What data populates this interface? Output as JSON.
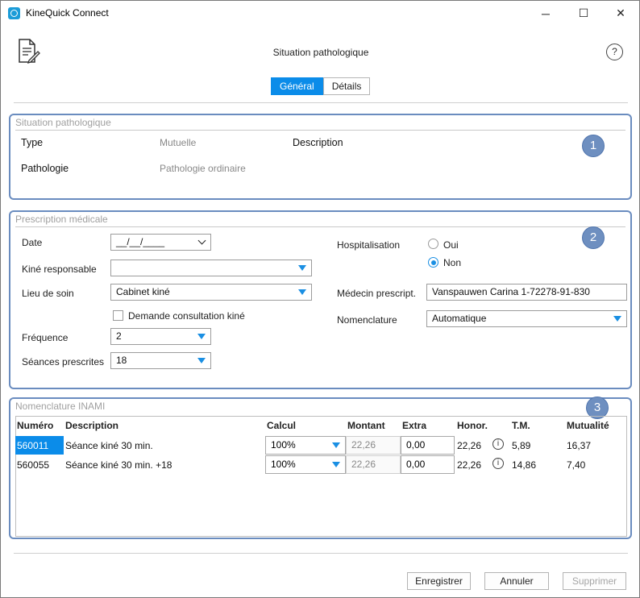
{
  "window": {
    "title": "KineQuick Connect",
    "minimize": "─",
    "maximize": "☐",
    "close": "✕"
  },
  "header": {
    "page_title": "Situation pathologique",
    "help": "?"
  },
  "tabs": [
    {
      "label": "Général",
      "active": true
    },
    {
      "label": "Détails",
      "active": false
    }
  ],
  "situation": {
    "legend": "Situation pathologique",
    "badge": "1",
    "type_label": "Type",
    "type_value": "Mutuelle",
    "description_label": "Description",
    "pathologie_label": "Pathologie",
    "pathologie_value": "Pathologie ordinaire"
  },
  "prescription": {
    "legend": "Prescription médicale",
    "badge": "2",
    "date_label": "Date",
    "date_value": "__/__/____",
    "kine_label": "Kiné responsable",
    "kine_value": "",
    "lieu_label": "Lieu de soin",
    "lieu_value": "Cabinet kiné",
    "consult_label": "Demande consultation kiné",
    "consult_checked": false,
    "frequence_label": "Fréquence",
    "frequence_value": "2",
    "seances_label": "Séances prescrites",
    "seances_value": "18",
    "hosp_label": "Hospitalisation",
    "hosp_oui": "Oui",
    "hosp_non": "Non",
    "hosp_selected": "Non",
    "medecin_label": "Médecin prescript.",
    "medecin_value": "Vanspauwen Carina  1-72278-91-830",
    "nomenclature_label": "Nomenclature",
    "nomenclature_value": "Automatique"
  },
  "inami": {
    "legend": "Nomenclature INAMI",
    "badge": "3",
    "columns": [
      "Numéro",
      "Description",
      "Calcul",
      "Montant",
      "Extra",
      "Honor.",
      "T.M.",
      "Mutualité"
    ],
    "rows": [
      {
        "numero": "560011",
        "description": "Séance kiné 30 min.",
        "calcul": "100%",
        "montant": "22,26",
        "extra": "0,00",
        "honor": "22,26",
        "tm": "5,89",
        "mutualite": "16,37",
        "selected": true
      },
      {
        "numero": "560055",
        "description": "Séance kiné 30 min. +18",
        "calcul": "100%",
        "montant": "22,26",
        "extra": "0,00",
        "honor": "22,26",
        "tm": "14,86",
        "mutualite": "7,40",
        "selected": false
      }
    ],
    "info_glyph": "i"
  },
  "footer": {
    "save": "Enregistrer",
    "cancel": "Annuler",
    "delete": "Supprimer"
  },
  "colors": {
    "accent": "#0b8ce9",
    "group_border": "#6a8cbf",
    "badge": "#6e8fc0"
  }
}
